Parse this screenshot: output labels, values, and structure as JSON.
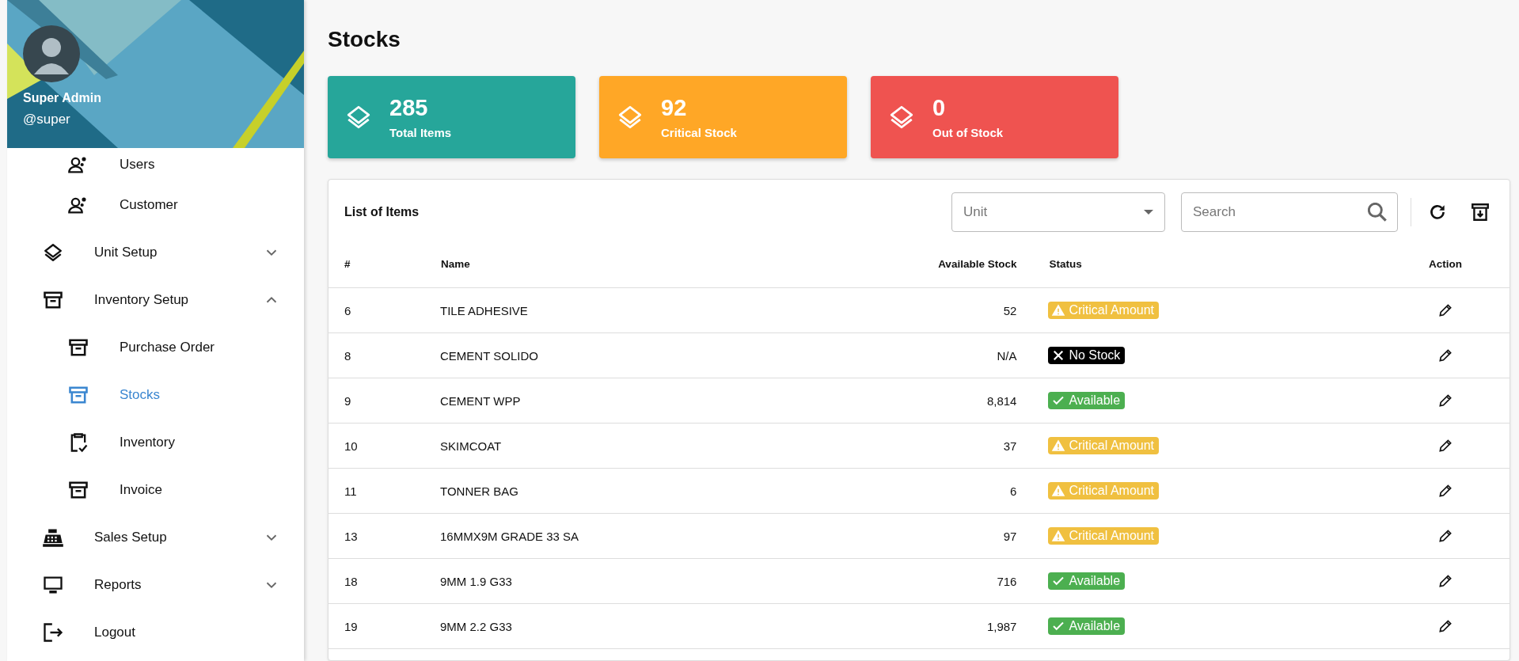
{
  "profile": {
    "name": "Super Admin",
    "handle": "@super"
  },
  "sidebar": {
    "items": [
      {
        "label": "Users",
        "kind": "child",
        "selected": false
      },
      {
        "label": "Customer",
        "kind": "child",
        "selected": false
      },
      {
        "label": "Unit Setup",
        "kind": "group",
        "selected": false,
        "expanded": false
      },
      {
        "label": "Inventory Setup",
        "kind": "group",
        "selected": false,
        "expanded": true,
        "children": [
          {
            "label": "Purchase Order",
            "selected": false
          },
          {
            "label": "Stocks",
            "selected": true
          },
          {
            "label": "Inventory",
            "selected": false
          },
          {
            "label": "Invoice",
            "selected": false
          }
        ]
      },
      {
        "label": "Sales Setup",
        "kind": "group",
        "selected": false,
        "expanded": false
      },
      {
        "label": "Reports",
        "kind": "group",
        "selected": false,
        "expanded": false
      },
      {
        "label": "Logout",
        "kind": "link",
        "selected": false
      }
    ]
  },
  "page_title": "Stocks",
  "summary_cards": [
    {
      "value": "285",
      "label": "Total Items",
      "color": "#26a69a"
    },
    {
      "value": "92",
      "label": "Critical Stock",
      "color": "#ffa726"
    },
    {
      "value": "0",
      "label": "Out of Stock",
      "color": "#ef5350"
    }
  ],
  "table": {
    "title": "List of Items",
    "unit_filter": {
      "placeholder": "Unit"
    },
    "search": {
      "placeholder": "Search"
    },
    "columns": [
      "#",
      "Name",
      "Available Stock",
      "Status",
      "Action"
    ],
    "rows": [
      {
        "id": "6",
        "name": "TILE ADHESIVE",
        "stock": "52",
        "status": "Critical Amount",
        "kind": "critical"
      },
      {
        "id": "8",
        "name": "CEMENT SOLIDO",
        "stock": "N/A",
        "status": "No Stock",
        "kind": "none"
      },
      {
        "id": "9",
        "name": "CEMENT WPP",
        "stock": "8,814",
        "status": "Available",
        "kind": "available"
      },
      {
        "id": "10",
        "name": "SKIMCOAT",
        "stock": "37",
        "status": "Critical Amount",
        "kind": "critical"
      },
      {
        "id": "11",
        "name": "TONNER BAG",
        "stock": "6",
        "status": "Critical Amount",
        "kind": "critical"
      },
      {
        "id": "13",
        "name": "16MMX9M GRADE 33 SA",
        "stock": "97",
        "status": "Critical Amount",
        "kind": "critical"
      },
      {
        "id": "18",
        "name": "9MM 1.9 G33",
        "stock": "716",
        "status": "Available",
        "kind": "available"
      },
      {
        "id": "19",
        "name": "9MM 2.2 G33",
        "stock": "1,987",
        "status": "Available",
        "kind": "available"
      }
    ]
  }
}
